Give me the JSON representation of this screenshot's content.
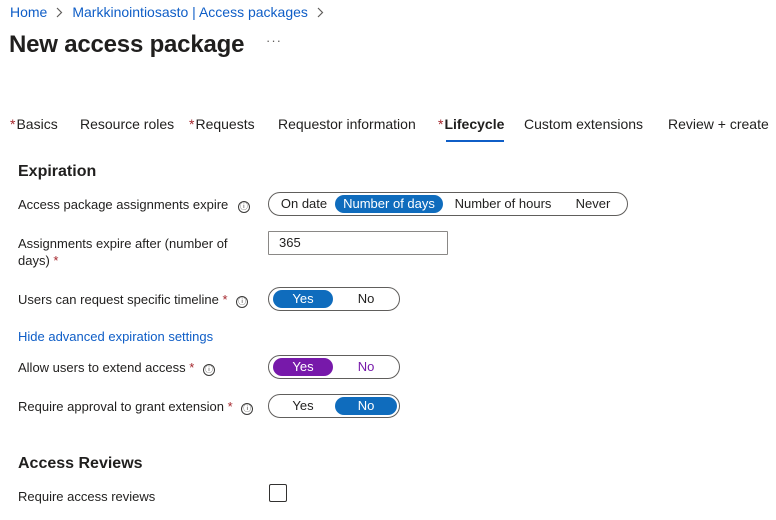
{
  "breadcrumb": {
    "items": [
      "Home",
      "Markkinointiosasto | Access packages"
    ]
  },
  "header": {
    "title": "New access package",
    "more": "···"
  },
  "tabs": [
    {
      "label": "Basics",
      "required": "*"
    },
    {
      "label": "Resource roles",
      "required": ""
    },
    {
      "label": "Requests",
      "required": "*"
    },
    {
      "label": "Requestor information",
      "required": ""
    },
    {
      "label": "Lifecycle",
      "required": "*"
    },
    {
      "label": "Custom extensions",
      "required": ""
    },
    {
      "label": "Review + create",
      "required": ""
    }
  ],
  "active_tab": "Lifecycle",
  "expiration": {
    "title": "Expiration",
    "assignments_expire": {
      "label": "Access package assignments expire",
      "options": [
        "On date",
        "Number of days",
        "Number of hours",
        "Never"
      ],
      "selected": "Number of days"
    },
    "expire_after": {
      "label_line1": "Assignments expire after (number of",
      "label_line2": "days)",
      "required": "*",
      "value": "365"
    },
    "specific_timeline": {
      "label": "Users can request specific timeline",
      "required": "*",
      "options": [
        "Yes",
        "No"
      ],
      "selected": "Yes"
    },
    "advanced_link": "Hide advanced expiration settings",
    "extend_access": {
      "label": "Allow users to extend access",
      "required": "*",
      "options": [
        "Yes",
        "No"
      ],
      "selected": "Yes"
    },
    "approval_extension": {
      "label": "Require approval to grant extension",
      "required": "*",
      "options": [
        "Yes",
        "No"
      ],
      "selected": "No"
    }
  },
  "access_reviews": {
    "title": "Access Reviews",
    "require_reviews": {
      "label": "Require access reviews",
      "checked": false
    }
  },
  "icons": {
    "info": "ⓘ",
    "chevron": "›"
  },
  "colors": {
    "link": "#0f5ec7",
    "selected": "#0f6cbd",
    "purple": "#7719aa",
    "required": "#a4262c"
  }
}
